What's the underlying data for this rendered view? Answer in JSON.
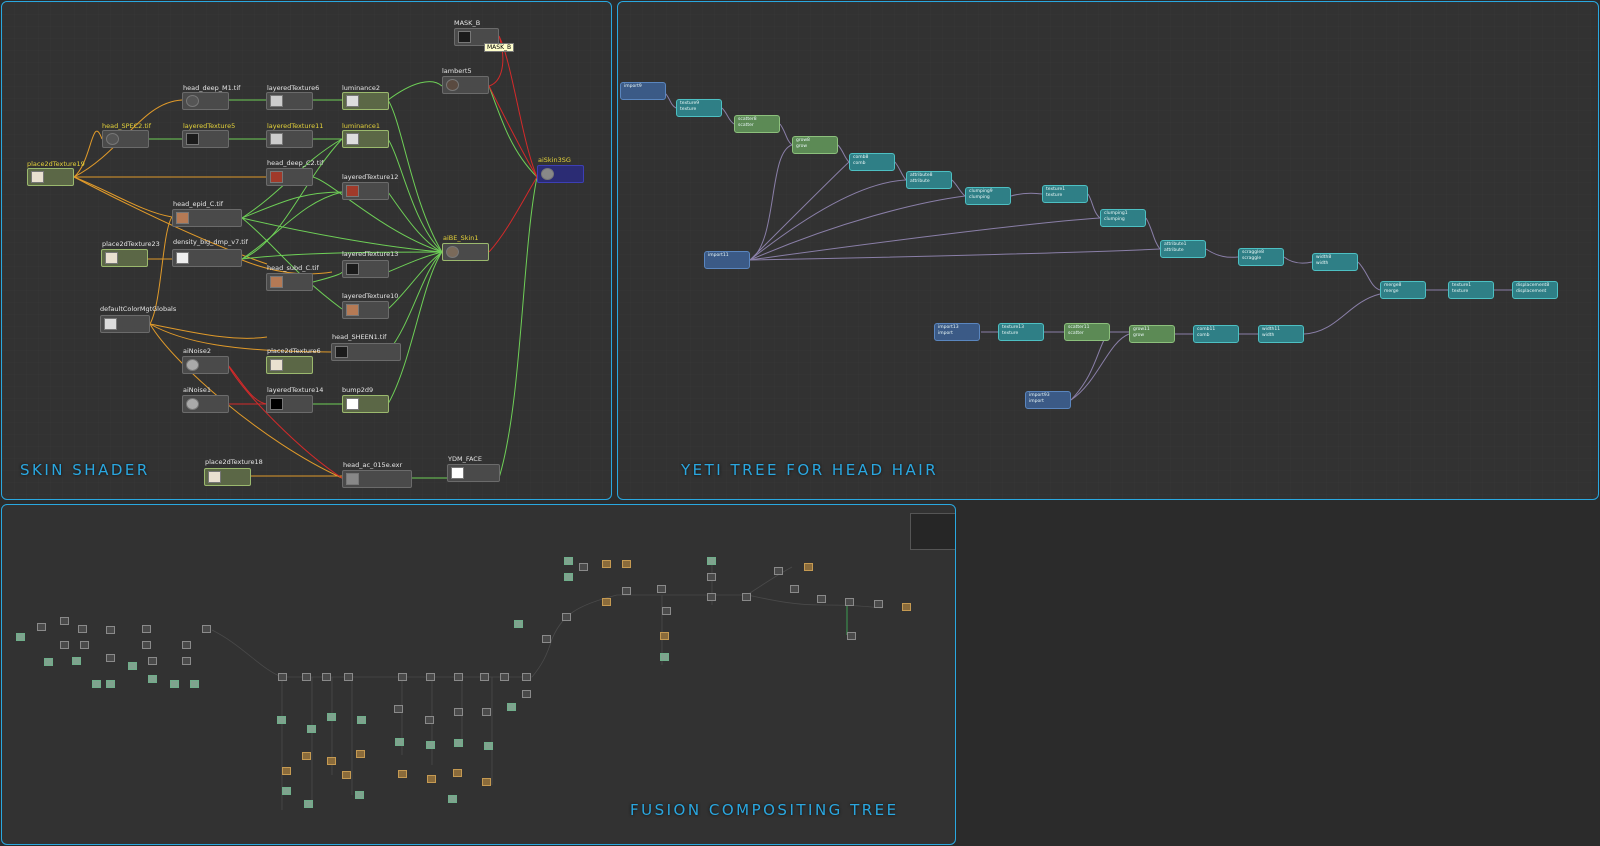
{
  "panels": {
    "skin": {
      "title": "SKIN SHADER"
    },
    "yeti": {
      "title": "YETI TREE FOR HEAD HAIR"
    },
    "fusion": {
      "title": "FUSION COMPOSITING TREE"
    }
  },
  "skin_nodes": {
    "mask": "MASK_B",
    "mask_tooltip": "MASK_B",
    "head_deep_m1": "head_deep_M1.tif",
    "layered6": "layeredTexture6",
    "luminance2": "luminance2",
    "lambert5": "lambert5",
    "head_spec2": "head_SPEC2.tif",
    "layered5": "layeredTexture5",
    "layered11": "layeredTexture11",
    "luminance1": "luminance1",
    "place2d19": "place2dTexture19",
    "aiskin3sg": "aiSkin3SG",
    "head_deep_c2": "head_deep_C2.tif",
    "layered12": "layeredTexture12",
    "head_epid_c": "head_epid_C.tif",
    "place2d23": "place2dTexture23",
    "density": "density_big_dmp_v7.tif",
    "aibe_skin1": "aiBE_Skin1",
    "head_subd_c": "head_subd_C.tif",
    "layered13": "layeredTexture13",
    "default_color": "defaultColorMgtGlobals",
    "layered10": "layeredTexture10",
    "ainoise2": "aiNoise2",
    "place2d6": "place2dTexture6",
    "head_sheen1": "head_SHEEN1.tif",
    "ainoise1": "aiNoise1",
    "layered14": "layeredTexture14",
    "bump2d9": "bump2d9",
    "place2d18": "place2dTexture18",
    "head_ac": "head_ac_015e.exr",
    "ydm_face": "YDM_FACE"
  },
  "yeti_nodes": [
    {
      "name": "import9",
      "sub": "",
      "color": "blue"
    },
    {
      "name": "texture9",
      "sub": "texture",
      "color": "teal"
    },
    {
      "name": "scatter8",
      "sub": "scatter",
      "color": "green"
    },
    {
      "name": "grow8",
      "sub": "grow",
      "color": "green"
    },
    {
      "name": "comb8",
      "sub": "comb",
      "color": "teal"
    },
    {
      "name": "attribute8",
      "sub": "attribute",
      "color": "teal"
    },
    {
      "name": "clumping9",
      "sub": "clumping",
      "color": "teal"
    },
    {
      "name": "texture1",
      "sub": "texture",
      "color": "teal"
    },
    {
      "name": "clumping1",
      "sub": "clumping",
      "color": "teal"
    },
    {
      "name": "import11",
      "sub": "",
      "color": "blue"
    },
    {
      "name": "attribute1",
      "sub": "attribute",
      "color": "teal"
    },
    {
      "name": "scraggle8",
      "sub": "scraggle",
      "color": "teal"
    },
    {
      "name": "width8",
      "sub": "width",
      "color": "teal"
    },
    {
      "name": "merge8",
      "sub": "merge",
      "color": "teal"
    },
    {
      "name": "texture1",
      "sub": "texture",
      "color": "teal"
    },
    {
      "name": "displacement8",
      "sub": "displacement",
      "color": "teal"
    },
    {
      "name": "import13",
      "sub": "import",
      "color": "blue"
    },
    {
      "name": "texture13",
      "sub": "texture",
      "color": "teal"
    },
    {
      "name": "scatter11",
      "sub": "scatter",
      "color": "green"
    },
    {
      "name": "grow11",
      "sub": "grow",
      "color": "green"
    },
    {
      "name": "comb11",
      "sub": "comb",
      "color": "teal"
    },
    {
      "name": "width11",
      "sub": "width",
      "color": "teal"
    },
    {
      "name": "import93",
      "sub": "import",
      "color": "blue"
    }
  ],
  "colors": {
    "accent": "#29a8e0",
    "wire_green": "#6ecf57",
    "wire_orange": "#e09a2a",
    "wire_red": "#d42a2a",
    "wire_purple": "#8a7fa8"
  }
}
